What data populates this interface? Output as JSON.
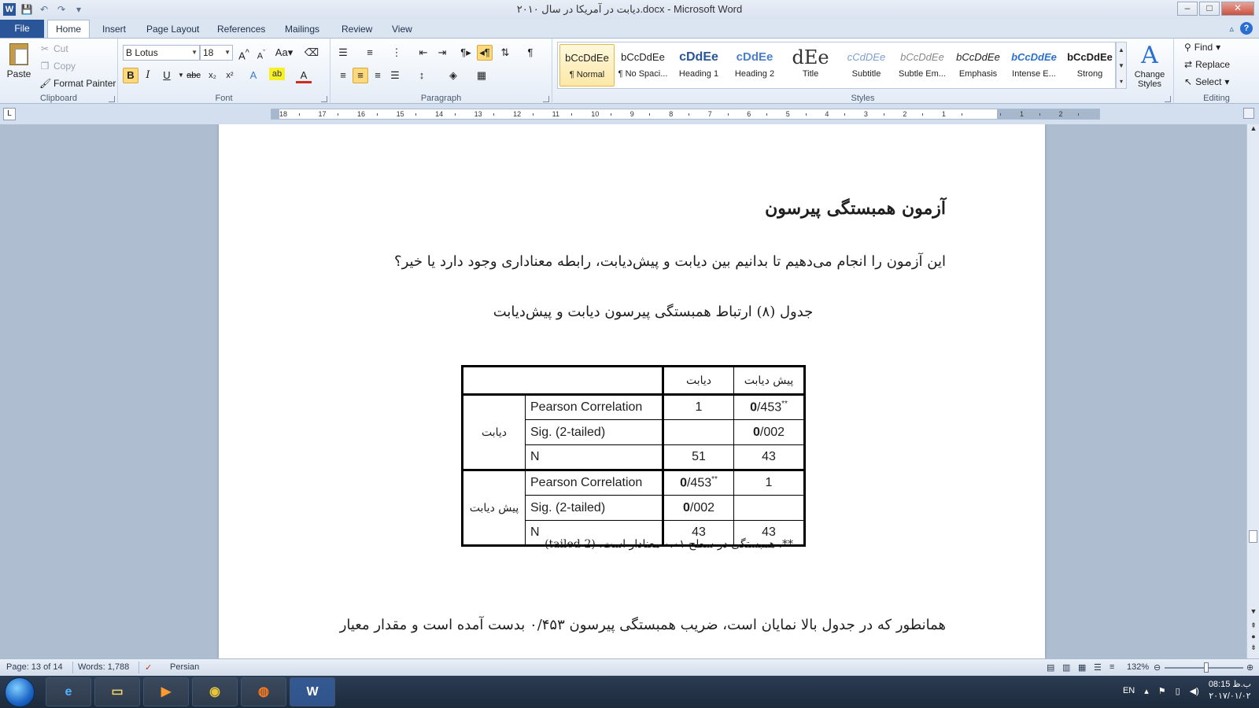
{
  "window": {
    "title": "دیابت در آمریکا در سال ۲۰۱۰.docx - Microsoft Word",
    "app_icon": "W",
    "controls": {
      "minimize": "–",
      "maximize": "□",
      "close": "✕"
    }
  },
  "tabs": {
    "file": "File",
    "items": [
      "Home",
      "Insert",
      "Page Layout",
      "References",
      "Mailings",
      "Review",
      "View"
    ],
    "active": "Home"
  },
  "ribbon": {
    "clipboard": {
      "paste": "Paste",
      "cut": "Cut",
      "copy": "Copy",
      "format_painter": "Format Painter",
      "label": "Clipboard"
    },
    "font": {
      "name": "B Lotus",
      "size": "18",
      "label": "Font",
      "case_btn": "Aa"
    },
    "paragraph": {
      "label": "Paragraph",
      "pilcrow": "¶"
    },
    "styles": {
      "label": "Styles",
      "items": [
        {
          "sample": "bCcDdEe",
          "name": "¶ Normal"
        },
        {
          "sample": "bCcDdEe",
          "name": "¶ No Spaci..."
        },
        {
          "sample": "cDdEe",
          "name": "Heading 1"
        },
        {
          "sample": "cDdEe",
          "name": "Heading 2"
        },
        {
          "sample": "dEe",
          "name": "Title"
        },
        {
          "sample": "cCdDEe",
          "name": "Subtitle"
        },
        {
          "sample": "bCcDdEe",
          "name": "Subtle Em..."
        },
        {
          "sample": "bCcDdEe",
          "name": "Emphasis"
        },
        {
          "sample": "bCcDdEe",
          "name": "Intense E..."
        },
        {
          "sample": "bCcDdEe",
          "name": "Strong"
        }
      ],
      "change_styles": "Change Styles"
    },
    "editing": {
      "label": "Editing",
      "find": "Find",
      "replace": "Replace",
      "select": "Select"
    }
  },
  "ruler": {
    "numbers": [
      "18",
      "17",
      "16",
      "15",
      "14",
      "13",
      "12",
      "11",
      "10",
      "9",
      "8",
      "7",
      "6",
      "5",
      "4",
      "3",
      "2",
      "1",
      "",
      "1",
      "2"
    ]
  },
  "document": {
    "heading": "آزمون همبستگی پیرسون",
    "para1": "این آزمون را انجام می‌دهیم تا بدانیم بین دیابت و پیش‌دیابت، رابطه معناداری وجود دارد یا خیر؟",
    "caption": "جدول (۸)  ارتباط همبستگی پیرسون دیابت و پیش‌دیابت",
    "table": {
      "col_headers": [
        "دیابت",
        "پیش دیابت"
      ],
      "group1": "دیابت",
      "group2": "پیش دیابت",
      "row_labels": [
        "Pearson Correlation",
        "Sig. (2-tailed)",
        "N"
      ],
      "g1": {
        "pc_col1": "1",
        "pc_col2_bold": "0",
        "pc_col2_rest": "/453",
        "pc_col2_sup": "**",
        "sig_col1": "",
        "sig_col2_bold": "0",
        "sig_col2_rest": "/002",
        "n_col1": "51",
        "n_col2": "43"
      },
      "g2": {
        "pc_col1_bold": "0",
        "pc_col1_rest": "/453",
        "pc_col1_sup": "**",
        "pc_col2": "1",
        "sig_col1_bold": "0",
        "sig_col1_rest": "/002",
        "sig_col2": "",
        "n_col1": "43",
        "n_col2": "43"
      }
    },
    "footnote": "**. همبستگی در سطح ۰.۰۱ معنادار است. (2-tailed)",
    "para2": "همانطور که در جدول بالا نمایان است، ضریب همبستگی پیرسون ۰/۴۵۳ بدست آمده است و مقدار معیار"
  },
  "status": {
    "page": "Page: 13 of 14",
    "words": "Words: 1,788",
    "language": "Persian",
    "zoom": "132%"
  },
  "taskbar": {
    "lang": "EN",
    "time": "08:15 ب.ظ",
    "date": "۲۰۱۷/۰۱/۰۲"
  }
}
